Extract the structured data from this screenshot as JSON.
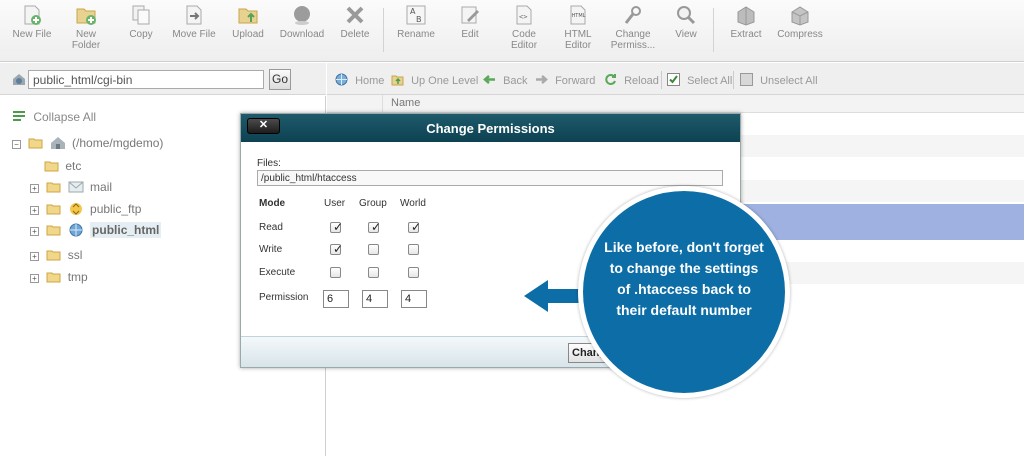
{
  "toolbar": {
    "buttons": [
      {
        "label": "New File",
        "icon": "new-file-icon"
      },
      {
        "label": "New Folder",
        "icon": "new-folder-icon"
      },
      {
        "label": "Copy",
        "icon": "copy-icon"
      },
      {
        "label": "Move File",
        "icon": "move-file-icon"
      },
      {
        "label": "Upload",
        "icon": "upload-icon"
      },
      {
        "label": "Download",
        "icon": "download-icon"
      },
      {
        "label": "Delete",
        "icon": "delete-icon"
      },
      {
        "label": "Rename",
        "icon": "rename-icon"
      },
      {
        "label": "Edit",
        "icon": "edit-icon"
      },
      {
        "label": "Code Editor",
        "icon": "code-editor-icon"
      },
      {
        "label": "HTML Editor",
        "icon": "html-editor-icon"
      },
      {
        "label": "Change Permiss...",
        "icon": "change-permissions-icon"
      },
      {
        "label": "View",
        "icon": "view-icon"
      },
      {
        "label": "Extract",
        "icon": "extract-icon"
      },
      {
        "label": "Compress",
        "icon": "compress-icon"
      }
    ],
    "new_file": "New File",
    "new_folder_1": "New",
    "new_folder_2": "Folder",
    "copy": "Copy",
    "move_file": "Move File",
    "upload": "Upload",
    "download": "Download",
    "delete": "Delete",
    "rename": "Rename",
    "edit": "Edit",
    "code_editor_1": "Code",
    "code_editor_2": "Editor",
    "html_editor_1": "HTML",
    "html_editor_2": "Editor",
    "change_perm_1": "Change",
    "change_perm_2": "Permiss...",
    "view": "View",
    "extract": "Extract",
    "compress": "Compress"
  },
  "path": {
    "value": "public_html/cgi-bin",
    "go_label": "Go"
  },
  "tree": {
    "collapse_all": "Collapse All",
    "root": "(/home/mgdemo)",
    "items": {
      "etc": "etc",
      "mail": "mail",
      "public_ftp": "public_ftp",
      "public_html": "public_html",
      "ssl": "ssl",
      "tmp": "tmp"
    },
    "expander_plus": "+",
    "expander_minus": "−"
  },
  "nav": {
    "home": "Home",
    "up_one_level": "Up One Level",
    "back": "Back",
    "forward": "Forward",
    "reload": "Reload",
    "select_all": "Select All",
    "unselect_all": "Unselect All"
  },
  "list": {
    "name_header": "Name"
  },
  "modal": {
    "title": "Change Permissions",
    "close_label": "✕",
    "files_label": "Files:",
    "files_value": "/public_html/htaccess",
    "mode_header": "Mode",
    "user_header": "User",
    "group_header": "Group",
    "world_header": "World",
    "read_label": "Read",
    "write_label": "Write",
    "execute_label": "Execute",
    "permission_label": "Permission",
    "permissions": {
      "read": {
        "user": true,
        "group": true,
        "world": true
      },
      "write": {
        "user": true,
        "group": false,
        "world": false
      },
      "execute": {
        "user": false,
        "group": false,
        "world": false
      }
    },
    "permission_user": "6",
    "permission_group": "4",
    "permission_world": "4",
    "change_button": "Change"
  },
  "callout": {
    "text": "Like before, don't forget to change the settings of .htaccess back to their default number"
  },
  "colors": {
    "modal_title_bg": "#0d4252",
    "callout_bg": "#0d6ea7",
    "selected_row": "#9eb1e1"
  }
}
